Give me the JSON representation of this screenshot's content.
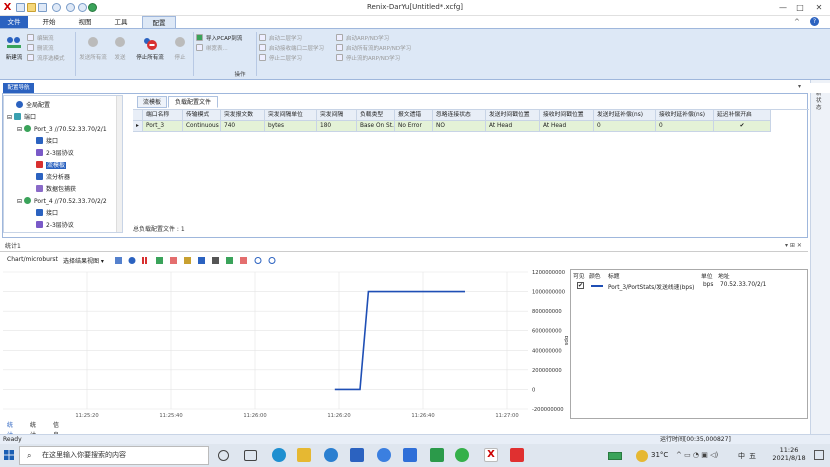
{
  "window": {
    "title": "Renix-DarYu[Untitled*.xcfg]",
    "app_logo": "X"
  },
  "ribbon_tabs": [
    "文件",
    "开始",
    "视图",
    "工具",
    "配置"
  ],
  "ribbon": {
    "group1": {
      "big": "新建流",
      "small": [
        "编辑流",
        "删流流",
        "流序选模式"
      ]
    },
    "group2": [
      "发送所有流",
      "发送",
      "停止所有流",
      "停止"
    ],
    "group3": [
      "导入PCAP到流",
      "绑宽表..."
    ],
    "group4": [
      "启动二层学习",
      "启动接收端口二层学习",
      "停止二层学习"
    ],
    "group5": [
      "启动ARP/ND学习",
      "启动所有流的ARP/ND学习",
      "停止流的ARP/ND学习"
    ],
    "group_label": "操作"
  },
  "nav": {
    "tab": "配置导航"
  },
  "tree": [
    "全局配置",
    "端口",
    "Port_3 //70.52.33.70/2/1",
    "接口",
    "2-3层协议",
    "流模板",
    "流分析器",
    "数据包捕获",
    "Port_4 //70.52.33.70/2/2",
    "接口",
    "2-3层协议"
  ],
  "subtabs": [
    "流模板",
    "负载配置文件"
  ],
  "grid": {
    "columns": [
      "端口名称",
      "传输模式",
      "突发报文数",
      "突发间隔单位",
      "突发间隔",
      "负载类型",
      "报文遗错",
      "忽略连接状态",
      "发送时间戳位置",
      "接收时间戳位置",
      "发送时延补偿(ns)",
      "接收时延补偿(ns)",
      "延迟补偿开启"
    ],
    "rows": [
      [
        "Port_3",
        "Continuous",
        "740",
        "bytes",
        "180",
        "Base On St...",
        "No Error",
        "NO",
        "At Head",
        "At Head",
        "0",
        "0",
        "✔"
      ]
    ],
    "footer": "总负载配置文件 : 1"
  },
  "stats_panel": {
    "title": "统计1",
    "toolbar": {
      "chart_label": "Chart/microburst",
      "view_select": "选择结果视图"
    },
    "legend_headers": [
      "可见",
      "颜色",
      "标题",
      "单位",
      "地址"
    ],
    "legend_row": {
      "title": "Port_3/PortStats/发送线速(bps)",
      "unit": "bps",
      "address": "70.52.33.70/2/1",
      "color": "#1f4fb5"
    },
    "bottom_tabs": [
      "统计1",
      "统计2",
      "信息"
    ]
  },
  "chart_data": {
    "type": "line",
    "x": [
      "11:25:20",
      "11:25:40",
      "11:26:00",
      "11:26:20",
      "11:26:40",
      "11:27:00"
    ],
    "x_ticks": [
      "11:25:20",
      "11:25:40",
      "11:26:00",
      "11:26:20",
      "11:26:40",
      "11:27:00"
    ],
    "y_ticks": [
      "1200000000",
      "1000000000",
      "800000000",
      "600000000",
      "400000000",
      "200000000",
      "0",
      "-200000000"
    ],
    "ylabel": "bps",
    "ylim": [
      -200000000,
      1200000000
    ],
    "series": [
      {
        "name": "Port_3/PortStats/发送线速(bps)",
        "points": [
          [
            "11:26:19",
            0
          ],
          [
            "11:26:25",
            0
          ],
          [
            "11:26:27",
            1000000000
          ],
          [
            "11:26:50",
            1000000000
          ],
          [
            "11:27:00",
            1000000000
          ]
        ]
      }
    ]
  },
  "status": {
    "left": "Ready",
    "right": "运行时间[00:35,000827]"
  },
  "taskbar": {
    "search_placeholder": "在这里输入你要搜索的内容",
    "weather": "31°C",
    "time": "11:26",
    "date": "2021/8/18",
    "ime": "中",
    "input_mode": "五"
  },
  "right_strip": "更新状态"
}
